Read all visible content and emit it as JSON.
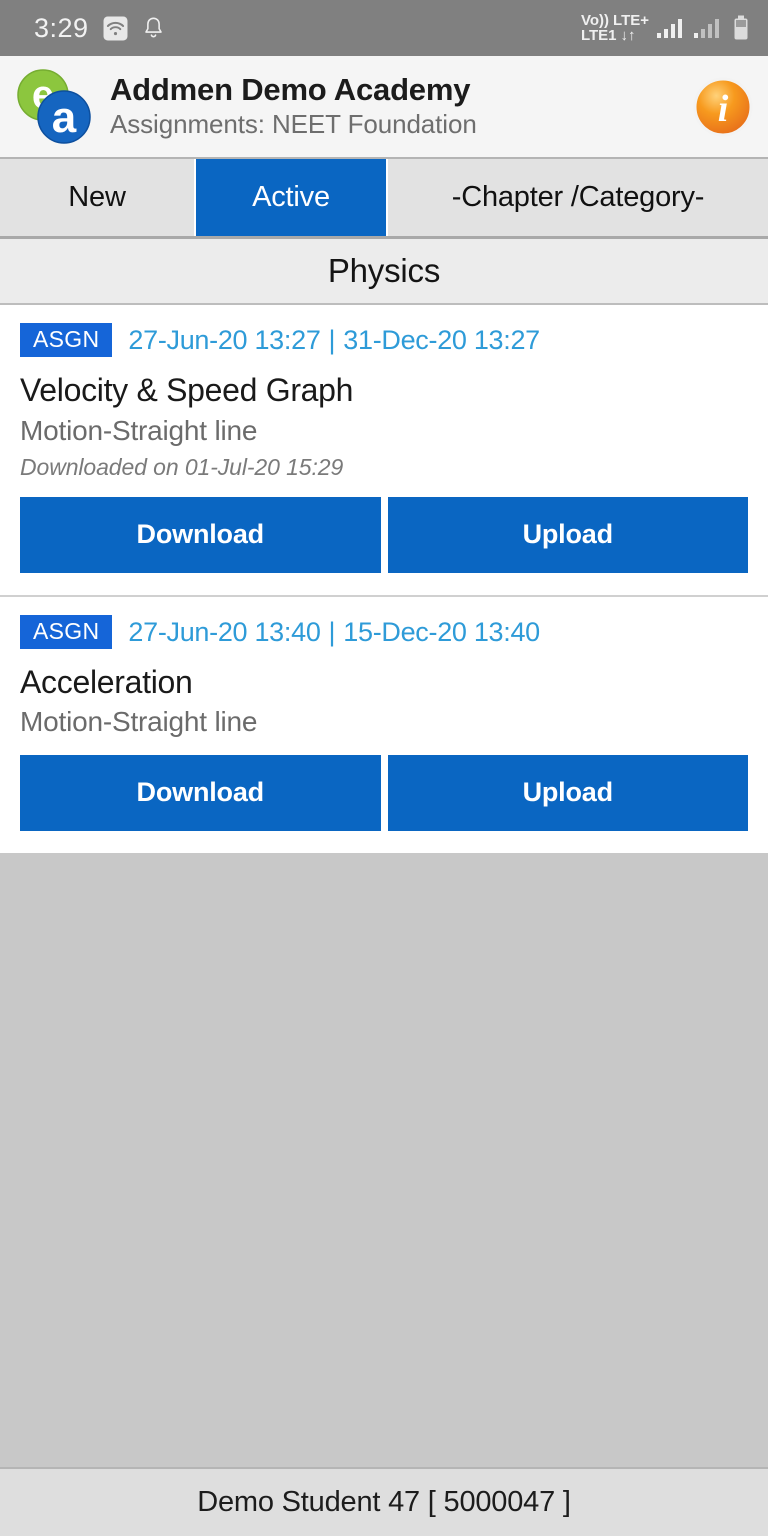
{
  "status_bar": {
    "time": "3:29",
    "wifi_icon": "wifi-icon",
    "notification_icon": "bell-icon",
    "volte_label": "Vo))",
    "network_label": "LTE1",
    "lte_label": "LTE+",
    "data_arrows": "↓↑",
    "signal_icon": "signal-bars-icon",
    "battery_icon": "battery-icon",
    "background_color": "#808080"
  },
  "header": {
    "logo_icon": "addmen-ea-logo-icon",
    "title": "Addmen Demo Academy",
    "subtitle": "Assignments: NEET Foundation",
    "info_icon": "info-icon",
    "info_color": "#f59120"
  },
  "tabs": [
    {
      "label": "New",
      "selected": false
    },
    {
      "label": "Active",
      "selected": true
    },
    {
      "label": "-Chapter /Category-",
      "selected": false
    }
  ],
  "subject": {
    "title": "Physics"
  },
  "assignments": [
    {
      "badge": "ASGN",
      "start_date": "27-Jun-20 13:27",
      "separator": "|",
      "end_date": "31-Dec-20 13:27",
      "title": "Velocity & Speed Graph",
      "chapter": "Motion-Straight line",
      "note": "Downloaded on 01-Jul-20 15:29",
      "download_label": "Download",
      "upload_label": "Upload"
    },
    {
      "badge": "ASGN",
      "start_date": "27-Jun-20 13:40",
      "separator": "|",
      "end_date": "15-Dec-20 13:40",
      "title": "Acceleration",
      "chapter": "Motion-Straight line",
      "note": "",
      "download_label": "Download",
      "upload_label": "Upload"
    }
  ],
  "footer": {
    "user": "Demo Student 47 [ 5000047 ]"
  },
  "colors": {
    "accent_blue": "#0a66c2",
    "badge_blue": "#1565d8",
    "date_blue": "#2e9bd8",
    "empty_gray": "#c8c8c8",
    "footer_gray": "#dedede"
  }
}
